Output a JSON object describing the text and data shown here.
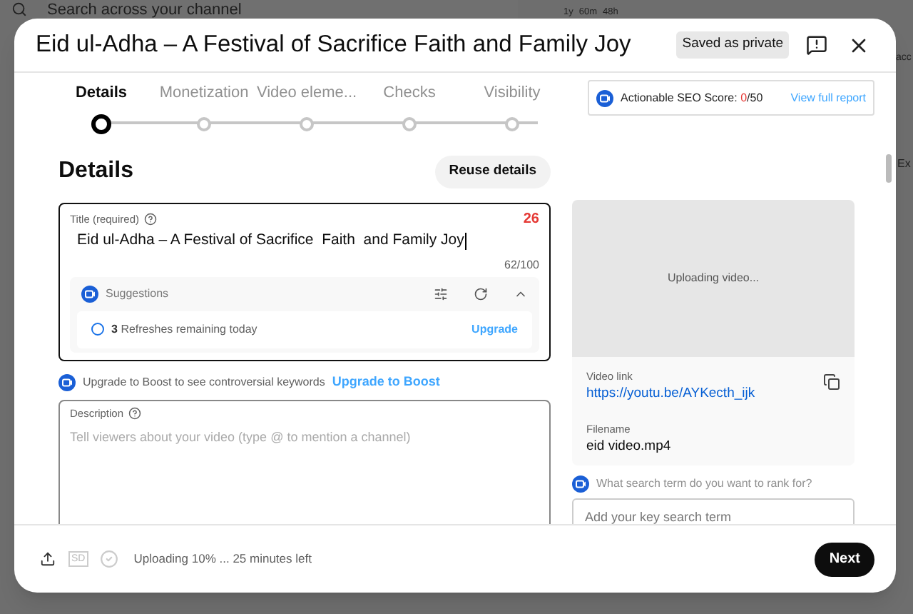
{
  "background": {
    "search_placeholder": "Search across your channel",
    "stats": [
      "1y",
      "60m",
      "48h"
    ],
    "edge_texts": [
      "acc",
      "Ex"
    ]
  },
  "dialog": {
    "title": "Eid ul-Adha – A Festival of Sacrifice Faith and Family Joy",
    "saved_badge": "Saved as private"
  },
  "steps": [
    {
      "label": "Details",
      "selected": true
    },
    {
      "label": "Monetization",
      "selected": false
    },
    {
      "label": "Video eleme...",
      "selected": false
    },
    {
      "label": "Checks",
      "selected": false
    },
    {
      "label": "Visibility",
      "selected": false
    }
  ],
  "seo": {
    "label": "Actionable SEO Score:",
    "score": "0",
    "total": "/50",
    "link": "View full report"
  },
  "details": {
    "heading": "Details",
    "reuse_button": "Reuse details"
  },
  "title_field": {
    "label": "Title (required)",
    "score": "26",
    "value": "Eid ul-Adha – A Festival of Sacrifice  Faith  and Family Joy",
    "counter": "62/100"
  },
  "suggestions": {
    "label": "Suggestions",
    "expanded": true,
    "count": "3",
    "refresh_text": "Refreshes remaining today",
    "upgrade": "Upgrade"
  },
  "boost": {
    "text": "Upgrade to Boost to see controversial keywords",
    "link": "Upgrade to Boost"
  },
  "description_field": {
    "label": "Description",
    "placeholder": "Tell viewers about your video (type @ to mention a channel)"
  },
  "video": {
    "status": "Uploading video...",
    "link_label": "Video link",
    "link": "https://youtu.be/AYKecth_ijk",
    "filename_label": "Filename",
    "filename": "eid video.mp4"
  },
  "search_term": {
    "question": "What search term do you want to rank for?",
    "placeholder": "Add your key search term"
  },
  "footer": {
    "status": "Uploading 10% ... 25 minutes left",
    "quality": "SD",
    "next": "Next"
  }
}
